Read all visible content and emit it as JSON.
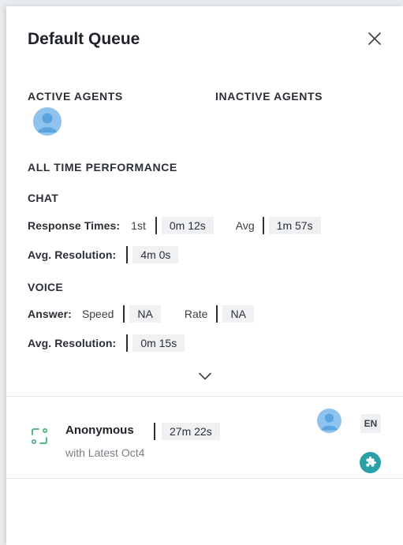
{
  "header": {
    "title": "Default Queue",
    "close_icon": "close-icon"
  },
  "agents": {
    "active_label": "ACTIVE AGENTS",
    "inactive_label": "INACTIVE AGENTS",
    "active_count_shown": 1,
    "avatar_color": "#8fc3ee"
  },
  "performance": {
    "heading": "ALL TIME PERFORMANCE",
    "chat": {
      "heading": "CHAT",
      "response_times_label": "Response Times:",
      "first_label": "1st",
      "first_value": "0m 12s",
      "avg_label": "Avg",
      "avg_value": "1m 57s",
      "resolution_label": "Avg. Resolution:",
      "resolution_value": "4m 0s"
    },
    "voice": {
      "heading": "VOICE",
      "answer_label": "Answer:",
      "speed_label": "Speed",
      "speed_value": "NA",
      "rate_label": "Rate",
      "rate_value": "NA",
      "resolution_label": "Avg. Resolution:",
      "resolution_value": "0m 15s"
    },
    "expand_icon": "chevron-down-icon"
  },
  "conversation": {
    "name": "Anonymous",
    "timer": "27m 22s",
    "subtitle": "with Latest Oct4",
    "language": "EN",
    "channel_icon": "conversation-icon",
    "app_icon": "puzzle-icon",
    "accent_green": "#3bb273",
    "app_color": "#2a9fa8"
  }
}
